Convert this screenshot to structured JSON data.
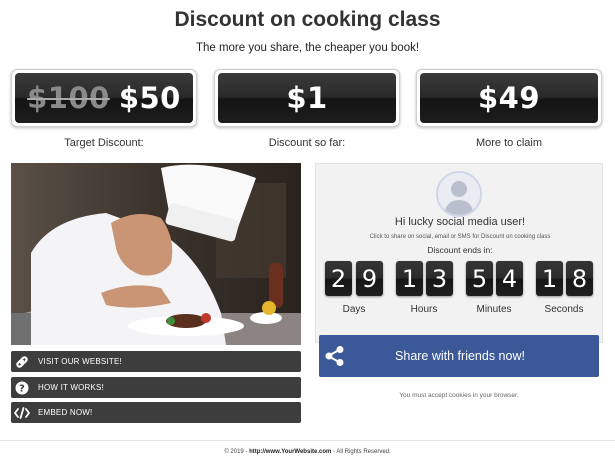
{
  "header": {
    "title": "Discount on cooking class",
    "subtitle": "The more you share, the cheaper you book!"
  },
  "prices": [
    {
      "old": "$100",
      "value": "$50",
      "label": "Target Discount:"
    },
    {
      "value": "$1",
      "label": "Discount so far:"
    },
    {
      "value": "$49",
      "label": "More to claim"
    }
  ],
  "actions": [
    {
      "label": "VISIT OUR WEBSITE!",
      "icon": "link-icon"
    },
    {
      "label": "HOW IT WORKS!",
      "icon": "question-icon"
    },
    {
      "label": "EMBED NOW!",
      "icon": "code-icon"
    }
  ],
  "panel": {
    "greeting": "Hi lucky social media user!",
    "note": "Click to share on social, email or SMS for Discount on cooking class",
    "ends_label": "Discount ends in:",
    "countdown": [
      {
        "digits": [
          "2",
          "9"
        ],
        "unit": "Days"
      },
      {
        "digits": [
          "1",
          "3"
        ],
        "unit": "Hours"
      },
      {
        "digits": [
          "5",
          "4"
        ],
        "unit": "Minutes"
      },
      {
        "digits": [
          "1",
          "8"
        ],
        "unit": "Seconds"
      }
    ]
  },
  "share": {
    "label": "Share with friends now!",
    "icon": "share-icon"
  },
  "cookie_note": "You must accept cookies in your browser.",
  "footer": {
    "copyright": "© 2019 - ",
    "url": "http://www.YourWebsite.com",
    "rights": " - All Rights Reserved."
  },
  "colors": {
    "share_button": "#3b5998",
    "action_bar": "#3d3d3d",
    "counter_bg": "#2b2b2b"
  }
}
